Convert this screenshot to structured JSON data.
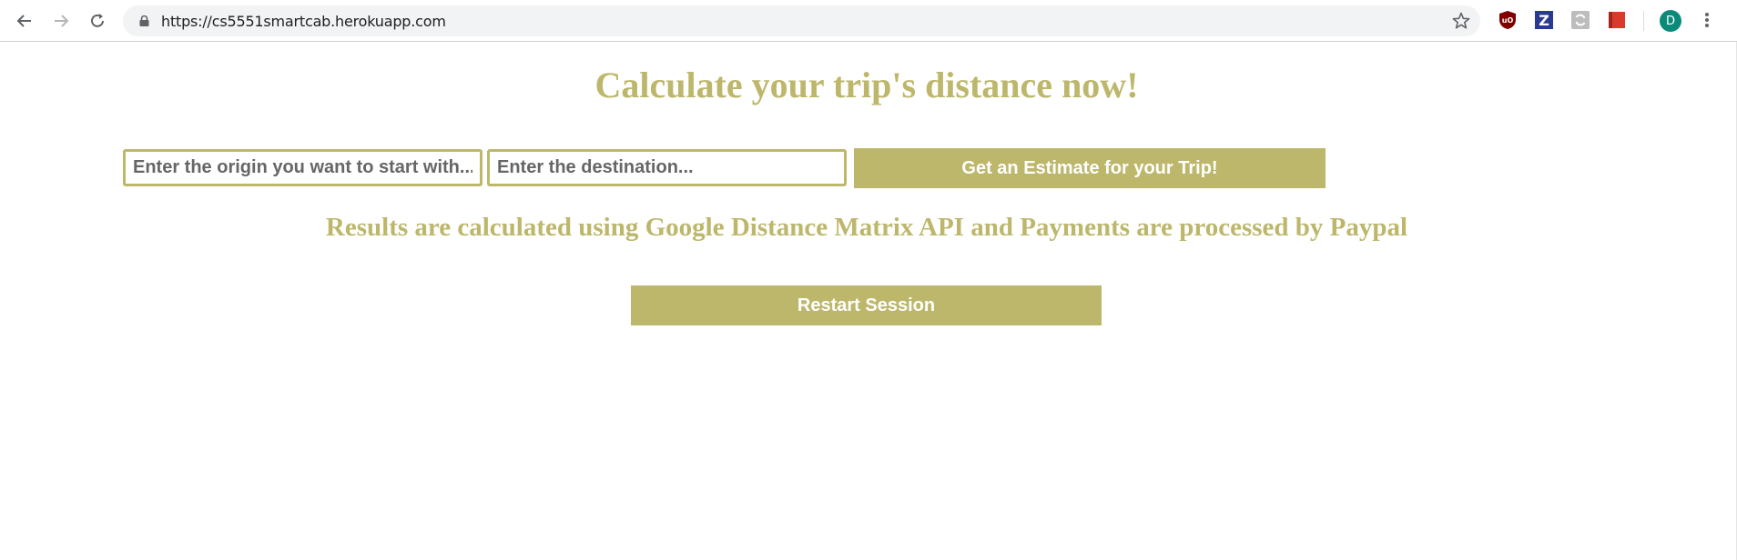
{
  "browser": {
    "url": "https://cs5551smartcab.herokuapp.com",
    "avatar_initial": "D",
    "extensions": [
      {
        "name": "ublock-origin-icon",
        "label": "uO"
      },
      {
        "name": "zotero-icon",
        "label": "Z"
      },
      {
        "name": "sync-extension-icon",
        "label": ""
      },
      {
        "name": "red-book-extension-icon",
        "label": ""
      }
    ]
  },
  "page": {
    "title": "Calculate your trip's distance now!",
    "origin_placeholder": "Enter the origin you want to start with...",
    "destination_placeholder": "Enter the destination...",
    "estimate_button": "Get an Estimate for your Trip!",
    "subtitle": "Results are calculated using Google Distance Matrix API and Payments are processed by Paypal",
    "restart_button": "Restart Session"
  },
  "colors": {
    "accent": "#bdb76b",
    "button_text": "#ffffff"
  }
}
